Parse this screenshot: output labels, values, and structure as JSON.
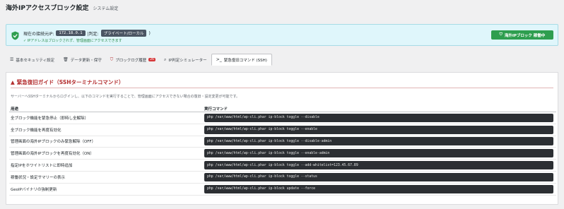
{
  "header": {
    "title": "海外IPアクセスブロック設定",
    "subtitle": "システム設定"
  },
  "status": {
    "ip_label": "現在の接続元IP:",
    "ip_value": "172.18.0.1",
    "judge_label": "|判定:",
    "network": "プライベート/ローカル",
    "network_suffix": ")",
    "allow_text": "✓ IPアドレスはブロックされず、管理画面にアクセスできます",
    "toggle_button": "海外IPブロック 稼働中",
    "colors": {
      "accent": "#2e9e4f",
      "banner_bg": "#dff6fb",
      "danger": "#b32d2e"
    }
  },
  "tabs": [
    {
      "label": "基本セキュリティ設定",
      "icon": "list-icon"
    },
    {
      "label": "データ更新・保守",
      "icon": "trash-icon"
    },
    {
      "label": "ブロックログ履歴",
      "icon": "shield-icon",
      "badge": "26"
    },
    {
      "label": "IP判定シミュレーター",
      "icon": "search-icon"
    },
    {
      "label": "緊急復旧コマンド (SSH)",
      "icon": "terminal-icon",
      "active": true
    }
  ],
  "panel": {
    "title": "緊急復旧ガイド（SSHターミナルコマンド）",
    "description": "サーバーへSSHターミナルからログインし、以下のコマンドを実行することで、管理画面にアクセスできない場合の復旧・設定変更が可能です。",
    "columns": {
      "usage": "用途",
      "command": "実行コマンド"
    },
    "rows": [
      {
        "usage": "全ブロック機能を緊急停止（即時し全解除）",
        "command": "php /var/www/html/wp-cli.phar ip-block toggle --disable"
      },
      {
        "usage": "全ブロック機能を再度有効化",
        "command": "php /var/www/html/wp-cli.phar ip-block toggle --enable"
      },
      {
        "usage": "管理画面の海外IPブロックのみ緊急解除（OFF）",
        "command": "php /var/www/html/wp-cli.phar ip-block toggle --disable-admin"
      },
      {
        "usage": "管理画面の海外IPブロックを再度有効化（ON）",
        "command": "php /var/www/html/wp-cli.phar ip-block toggle --enable-admin"
      },
      {
        "usage": "指定IPをホワイトリストに即時追加",
        "command": "php /var/www/html/wp-cli.phar ip-block toggle --add-whitelist=123.45.67.89"
      },
      {
        "usage": "稼働状況・設定サマリーの表示",
        "command": "php /var/www/html/wp-cli.phar ip-block toggle --status"
      },
      {
        "usage": "GeoIPバイナリの強制更新",
        "command": "php /var/www/html/wp-cli.phar ip-block update --force"
      }
    ]
  }
}
